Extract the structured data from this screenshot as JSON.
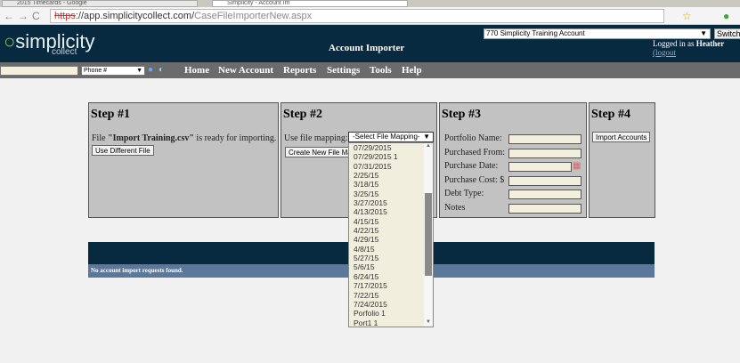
{
  "browser": {
    "tabs": [
      "2015 Timecards - Google",
      "Simplicity - Account Im"
    ],
    "url_scheme": "https",
    "url_host": "://app.simplicitycollect.com/",
    "url_path": "CaseFileImporterNew.aspx"
  },
  "header": {
    "logo": "simplicity",
    "logo_sub": "collect",
    "title": "Account Importer",
    "account_select": "770 Simplicity Training Account",
    "switch_label": "Switch",
    "logged_in_prefix": "Logged in as ",
    "user": "Heather",
    "logout": "(logout"
  },
  "nav": {
    "search_type": "Phone #",
    "items": [
      "Home",
      "New Account",
      "Reports",
      "Settings",
      "Tools",
      "Help"
    ]
  },
  "step1": {
    "title": "Step #1",
    "text_pre": "File ",
    "file": "\"Import Training.csv\"",
    "text_post": " is ready for importing.",
    "button": "Use Different File"
  },
  "step2": {
    "title": "Step #2",
    "label": "Use file mapping:",
    "select": "-Select File Mapping-",
    "button": "Create New File Mapping",
    "options": [
      "07/29/2015",
      "07/29/2015 1",
      "07/31/2015",
      "2/25/15",
      "3/18/15",
      "3/25/15",
      "3/27/2015",
      "4/13/2015",
      "4/15/15",
      "4/22/15",
      "4/29/15",
      "4/8/15",
      "5/27/15",
      "5/6/15",
      "6/24/15",
      "7/17/2015",
      "7/22/15",
      "7/24/2015",
      "Porfolio 1",
      "Port1 1"
    ]
  },
  "step3": {
    "title": "Step #3",
    "fields": [
      "Portfolio Name:",
      "Purchased From:",
      "Purchase Date:",
      "Purchase Cost: $",
      "Debt Type:",
      "Notes"
    ]
  },
  "step4": {
    "title": "Step #4",
    "button": "Import Accounts"
  },
  "requests": {
    "title": "Accou",
    "empty": "No account import requests found."
  }
}
